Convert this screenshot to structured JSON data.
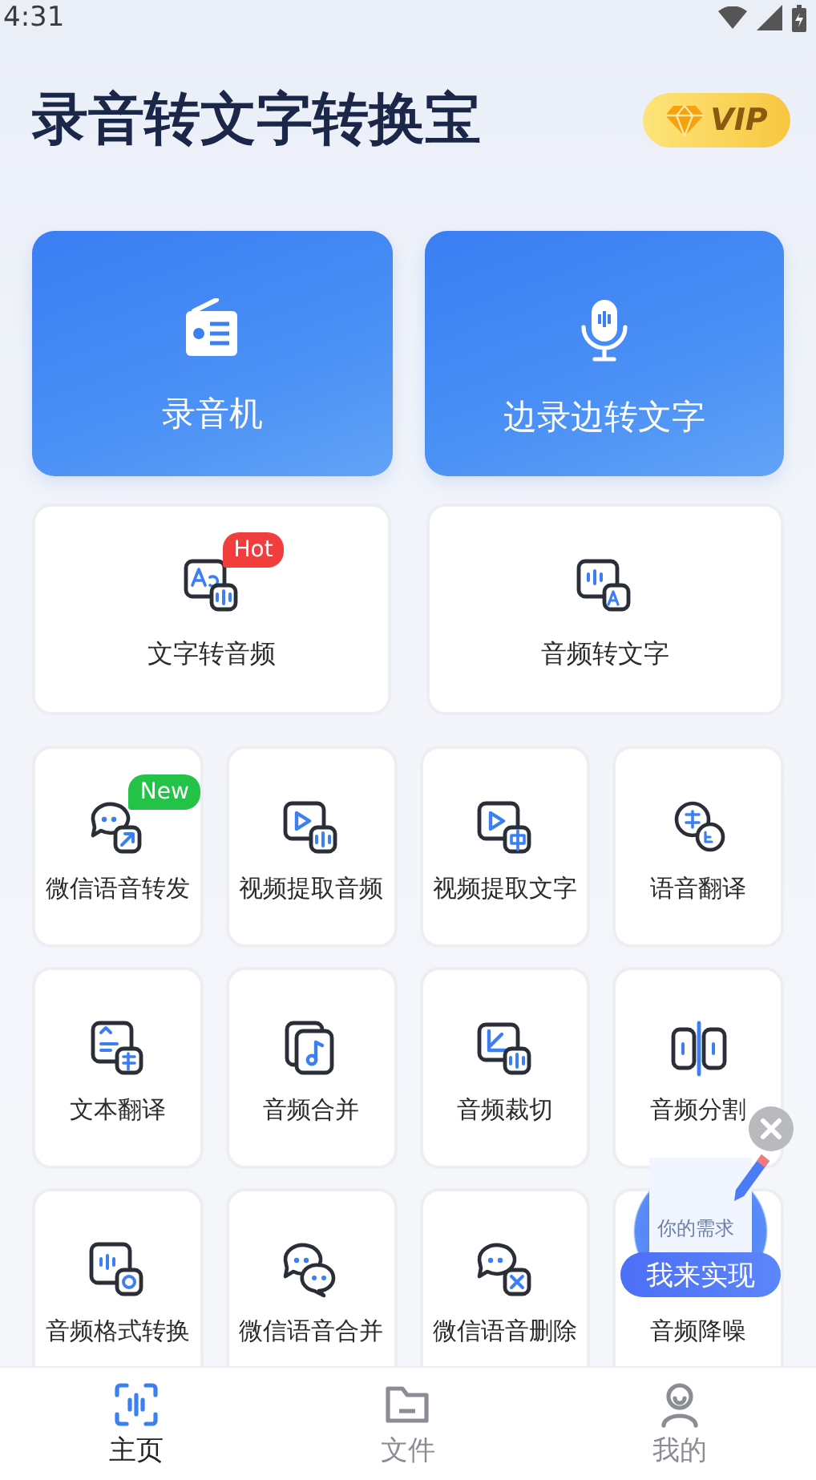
{
  "status_bar": {
    "time": "4:31"
  },
  "header": {
    "title": "录音转文字转换宝",
    "vip_badge": "VIP"
  },
  "primary_actions": [
    {
      "label": "录音机"
    },
    {
      "label": "边录边转文字"
    }
  ],
  "featured_tools": [
    {
      "label": "文字转音频",
      "badge": {
        "text": "Hot",
        "color": "#f23d3d"
      }
    },
    {
      "label": "音频转文字"
    }
  ],
  "tools": [
    {
      "label": "微信语音转发",
      "badge": {
        "text": "New",
        "color": "#22c346"
      }
    },
    {
      "label": "视频提取音频"
    },
    {
      "label": "视频提取文字"
    },
    {
      "label": "语音翻译"
    },
    {
      "label": "文本翻译"
    },
    {
      "label": "音频合并"
    },
    {
      "label": "音频裁切"
    },
    {
      "label": "音频分割"
    },
    {
      "label": "音频格式转换"
    },
    {
      "label": "微信语音合并"
    },
    {
      "label": "微信语音删除"
    },
    {
      "label": "音频降噪"
    }
  ],
  "floating_promo": {
    "caption": "你的需求",
    "button": "我来实现"
  },
  "tab_bar": [
    {
      "label": "主页",
      "selected": true
    },
    {
      "label": "文件",
      "selected": false
    },
    {
      "label": "我的",
      "selected": false
    }
  ]
}
